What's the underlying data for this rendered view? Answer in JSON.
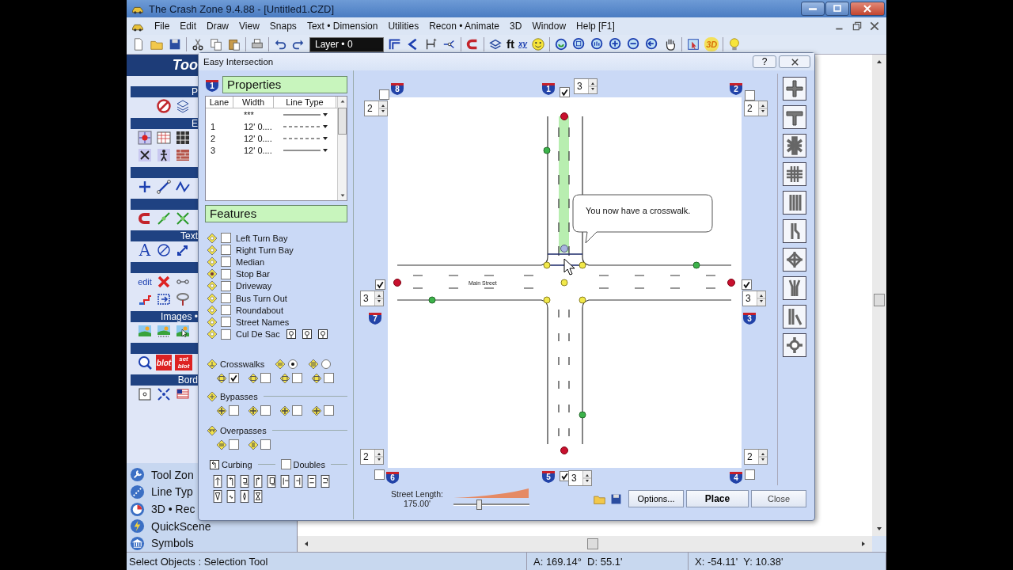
{
  "app": {
    "title": "The Crash Zone 9.4.88  - [Untitled1.CZD]",
    "menu": [
      "File",
      "Edit",
      "Draw",
      "View",
      "Snaps",
      "Text • Dimension",
      "Utilities",
      "Recon • Animate",
      "3D",
      "Window",
      "Help [F1]"
    ],
    "layer": "Layer • 0",
    "toolbar_labels": [
      "ft",
      "xy",
      "3D"
    ]
  },
  "toolbox": {
    "title": "Too",
    "section_labels": [
      "P",
      "E",
      "Text",
      "Images •",
      "Bord"
    ],
    "icon_labels": [
      "A",
      "edit",
      "blot",
      "set blot"
    ]
  },
  "nav": [
    "Tool Zon",
    "Line Typ",
    "3D • Rec",
    "QuickScene",
    "Symbols"
  ],
  "dialog": {
    "title": "Easy Intersection",
    "help": "?",
    "properties": {
      "title": "Properties",
      "shield": "1",
      "columns": [
        "Lane",
        "Width",
        "Line Type"
      ],
      "lanes": [
        {
          "width": "***",
          "dashed": false
        },
        {
          "lane": "1",
          "width": "12' 0....",
          "dashed": true
        },
        {
          "lane": "2",
          "width": "12' 0....",
          "dashed": true
        },
        {
          "lane": "3",
          "width": "12' 0....",
          "dashed": false
        }
      ]
    },
    "features": {
      "title": "Features",
      "items": [
        {
          "label": "Left Turn Bay",
          "checked": false,
          "kind": "plain"
        },
        {
          "label": "Right Turn Bay",
          "checked": false,
          "kind": "plain"
        },
        {
          "label": "Median",
          "checked": false,
          "kind": "plain"
        },
        {
          "label": "Stop Bar",
          "checked": false,
          "kind": "plain"
        },
        {
          "label": "Driveway",
          "checked": false,
          "kind": "plain"
        },
        {
          "label": "Bus Turn Out",
          "checked": false,
          "kind": "plain"
        },
        {
          "label": "Roundabout",
          "checked": false,
          "kind": "plain"
        },
        {
          "label": "Street Names",
          "checked": false,
          "kind": "plain"
        },
        {
          "label": "Cul De Sac",
          "checked": false,
          "kind": "shapes"
        }
      ]
    },
    "crosswalks": {
      "label": "Crosswalks",
      "styles": [
        {
          "selected": true
        },
        {
          "selected": false
        }
      ],
      "checks": [
        true,
        false,
        false,
        false
      ]
    },
    "bypasses": {
      "label": "Bypasses",
      "checks": [
        false,
        false,
        false,
        false
      ]
    },
    "overpasses": {
      "label": "Overpasses",
      "checks": [
        false,
        false
      ]
    },
    "curbing": {
      "label": "Curbing"
    },
    "doubles": {
      "label": "Doubles",
      "checked": false
    },
    "legs": [
      {
        "number": "8",
        "checked": false,
        "lanes": "2"
      },
      {
        "number": "1",
        "checked": true,
        "lanes": "3"
      },
      {
        "number": "2",
        "checked": false,
        "lanes": "2"
      },
      {
        "number": "7",
        "checked": true,
        "lanes": "3"
      },
      {
        "number": "3",
        "checked": true,
        "lanes": "3"
      },
      {
        "number": "6",
        "checked": false,
        "lanes": "2"
      },
      {
        "number": "5",
        "checked": true,
        "lanes": "3"
      },
      {
        "number": "4",
        "checked": false,
        "lanes": "2"
      }
    ],
    "street_name": "Main Street",
    "tooltip": "You now have a crosswalk.",
    "street_length": {
      "label": "Street Length:",
      "value": "175.00'",
      "level": 0.3
    },
    "buttons": [
      "Options...",
      "Place",
      "Close"
    ]
  },
  "status": [
    "Select Objects : Selection Tool",
    "A: 169.14°  D: 55.1'",
    "X: -54.11'  Y: 10.38'"
  ]
}
